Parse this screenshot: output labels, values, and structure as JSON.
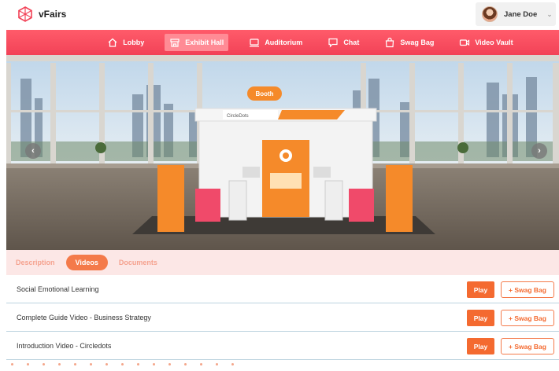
{
  "brand": {
    "name": "vFairs",
    "logo_icon": "hexagon-logo-icon",
    "accent": "#f24257"
  },
  "user": {
    "name": "Jane Doe",
    "menu_icon": "chevron-down-icon"
  },
  "nav": [
    {
      "label": "Lobby",
      "icon": "home-icon"
    },
    {
      "label": "Exhibit Hall",
      "icon": "booth-icon",
      "active": true
    },
    {
      "label": "Auditorium",
      "icon": "monitor-icon"
    },
    {
      "label": "Chat",
      "icon": "chat-icon"
    },
    {
      "label": "Swag Bag",
      "icon": "bag-icon"
    },
    {
      "label": "Video Vault",
      "icon": "video-icon"
    }
  ],
  "scene": {
    "booth_tag": "Booth",
    "booth_company": "CircleDots",
    "left_arrow": "‹",
    "right_arrow": "›"
  },
  "tabs": [
    {
      "label": "Description"
    },
    {
      "label": "Videos",
      "active": true
    },
    {
      "label": "Documents"
    }
  ],
  "videos": [
    {
      "title": "Social Emotional Learning",
      "play": "Play",
      "swag": "+ Swag Bag"
    },
    {
      "title": "Complete Guide Video - Business Strategy",
      "play": "Play",
      "swag": "+ Swag Bag"
    },
    {
      "title": "Introduction Video - Circledots",
      "play": "Play",
      "swag": "+ Swag Bag"
    }
  ]
}
